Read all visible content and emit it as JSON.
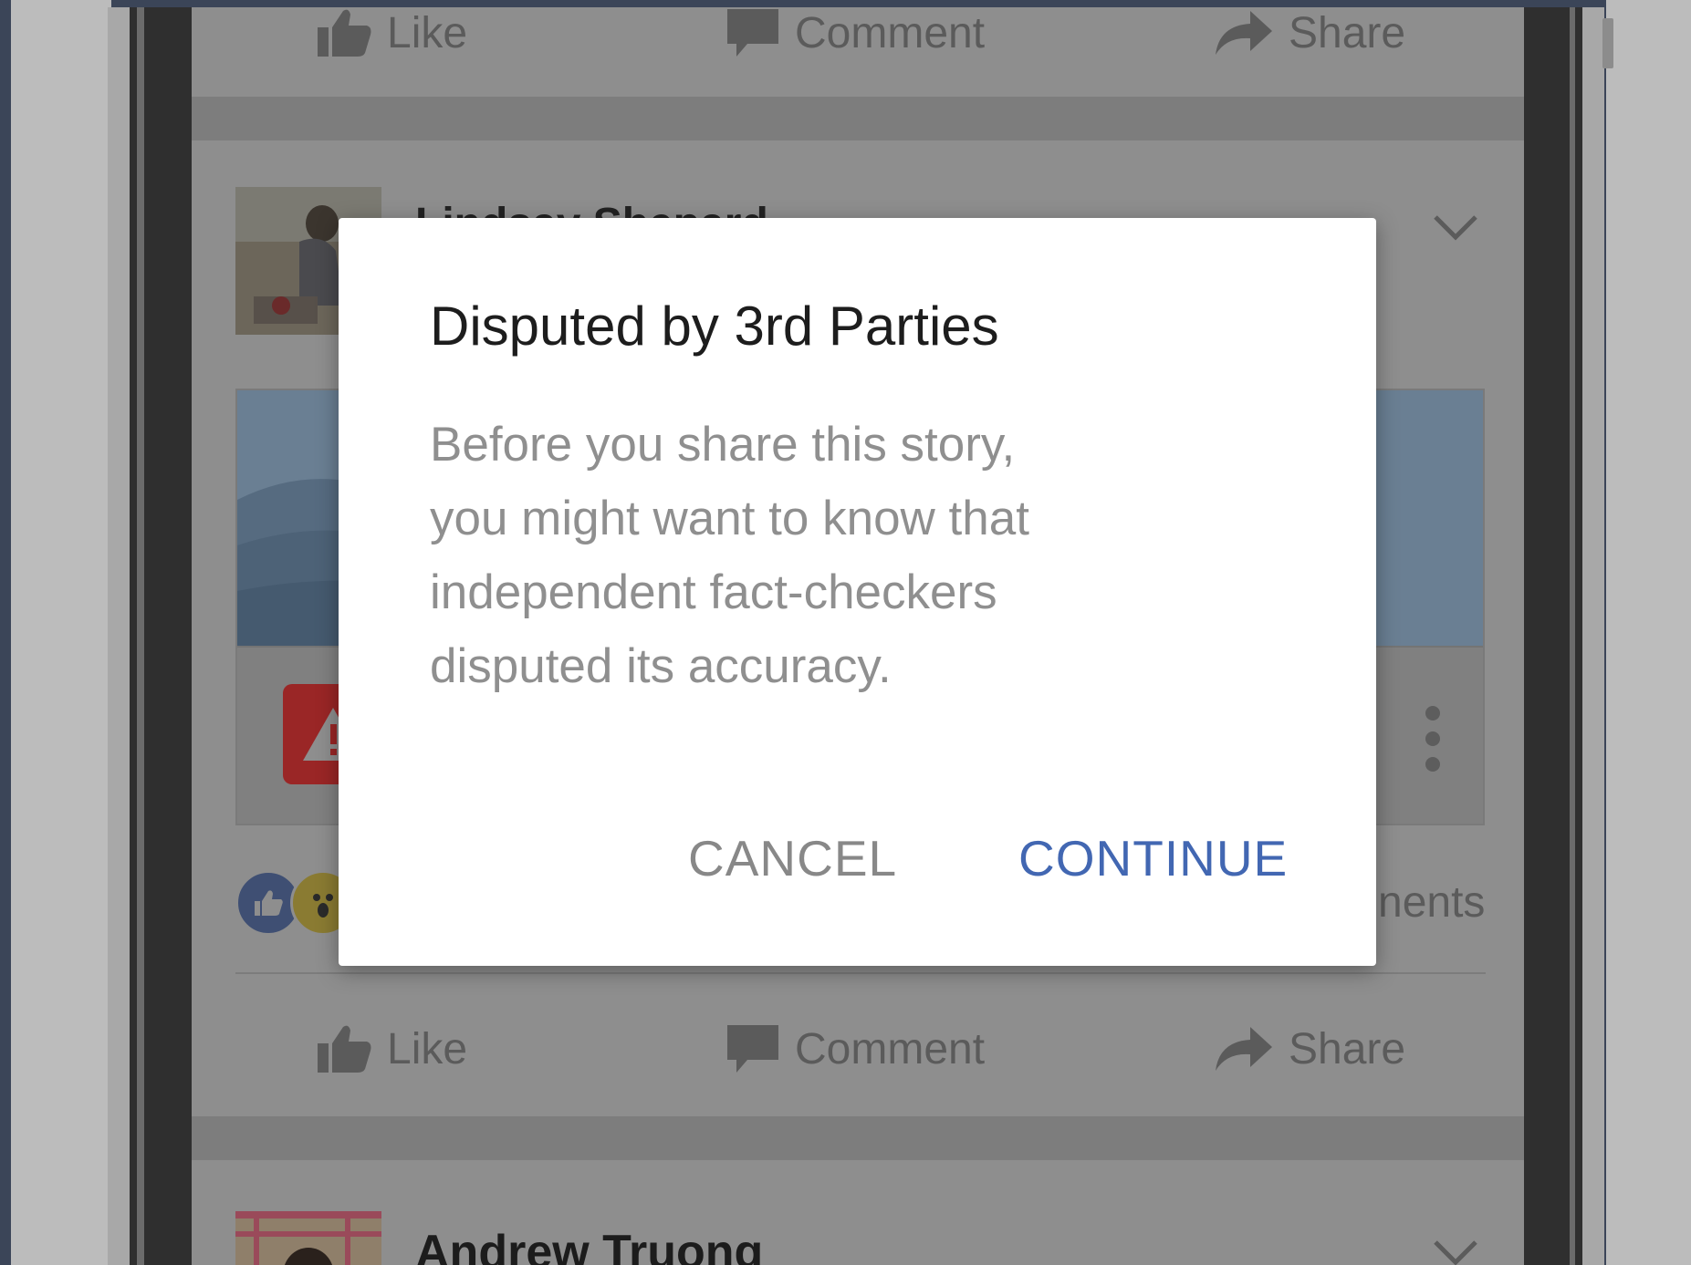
{
  "top_actions": {
    "like": "Like",
    "comment": "Comment",
    "share": "Share"
  },
  "post1": {
    "author_partial": "Lindsay Shepard",
    "reactions_count_partial": "nents"
  },
  "post_actions": {
    "like": "Like",
    "comment": "Comment",
    "share": "Share"
  },
  "post2": {
    "author": "Andrew Truong"
  },
  "dialog": {
    "title": "Disputed by 3rd Parties",
    "body_lines": [
      "Before you share this story,",
      "you might want to know that",
      "independent fact-checkers",
      "disputed its accuracy."
    ],
    "cancel_label": "CANCEL",
    "continue_label": "CONTINUE"
  },
  "colors": {
    "accent": "#4267b2",
    "warning": "#e0262f",
    "overlay": "rgba(0,0,0,0.45)"
  },
  "icons": [
    "thumbs-up-icon",
    "comment-bubble-icon",
    "share-arrow-icon",
    "chevron-down-icon",
    "warning-triangle-icon",
    "kebab-menu-icon"
  ]
}
